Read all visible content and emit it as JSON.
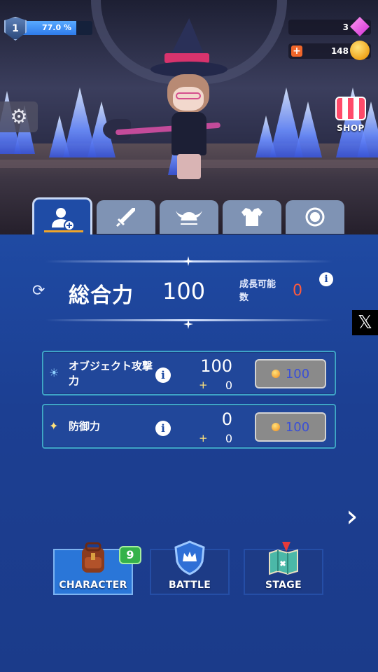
{
  "hud": {
    "level": "1",
    "exp_percent_text": "77.0 %",
    "exp_fraction": 0.77,
    "gems": "3",
    "gold": "148",
    "shop_label": "SHOP"
  },
  "tabs": [
    {
      "name": "character-stats",
      "icon": "user-plus-icon",
      "active": true
    },
    {
      "name": "weapon",
      "icon": "sword-icon",
      "active": false
    },
    {
      "name": "helmet",
      "icon": "viking-helmet-icon",
      "active": false
    },
    {
      "name": "armor",
      "icon": "armor-icon",
      "active": false
    },
    {
      "name": "accessory",
      "icon": "ring-icon",
      "active": false
    }
  ],
  "total": {
    "label": "総合力",
    "value": "100",
    "growth_label": "成長可能数",
    "growth_value": "0"
  },
  "stats": [
    {
      "label": "オブジェクト攻撃力",
      "value": "100",
      "bonus_plus": "+",
      "bonus": "0",
      "cost": "100",
      "icon": "sun-icon"
    },
    {
      "label": "防御力",
      "value": "0",
      "bonus_plus": "+",
      "bonus": "0",
      "cost": "100",
      "icon": "sparkle-icon"
    }
  ],
  "nav": {
    "character": {
      "label": "CHARACTER",
      "badge": "9"
    },
    "battle": {
      "label": "BATTLE"
    },
    "stage": {
      "label": "STAGE"
    }
  },
  "colors": {
    "panel_bg": "#1f4aa3",
    "accent_active_tab": "#f0a52a",
    "growth_value": "#ff5a3c",
    "badge_green": "#35b24a"
  }
}
